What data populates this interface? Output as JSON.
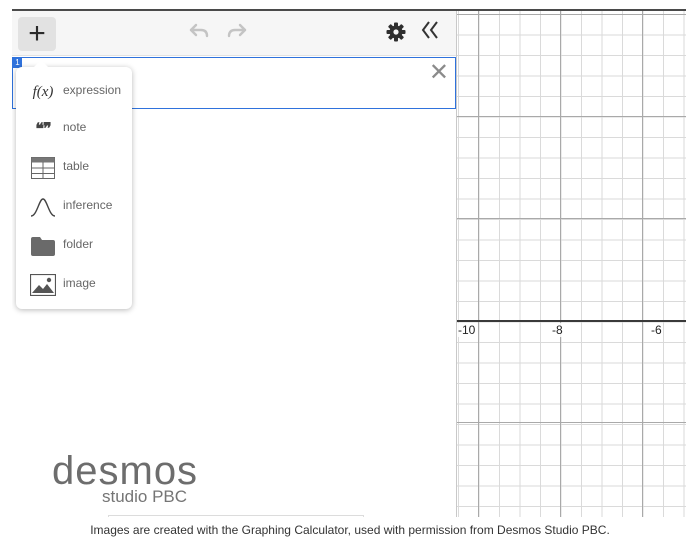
{
  "toolbar": {
    "add_label": "+"
  },
  "expression_list": {
    "row_index": "1",
    "close_glyph": "✕"
  },
  "add_menu": {
    "items": [
      {
        "label": "expression",
        "icon": "function-icon",
        "glyph": "f(x)"
      },
      {
        "label": "note",
        "icon": "quote-icon",
        "glyph": "❝❞"
      },
      {
        "label": "table",
        "icon": "table-icon"
      },
      {
        "label": "inference",
        "icon": "bell-curve-icon"
      },
      {
        "label": "folder",
        "icon": "folder-icon"
      },
      {
        "label": "image",
        "icon": "image-icon"
      }
    ]
  },
  "logo": {
    "main": "desmos",
    "sub": "studio PBC"
  },
  "graph": {
    "x_tick_labels": [
      "-10",
      "-8",
      "-6"
    ],
    "grid_color": "#dadada",
    "axis_color": "#3a3a3a"
  },
  "caption": "Images are created with the Graphing Calculator, used with permission from Desmos Studio PBC."
}
